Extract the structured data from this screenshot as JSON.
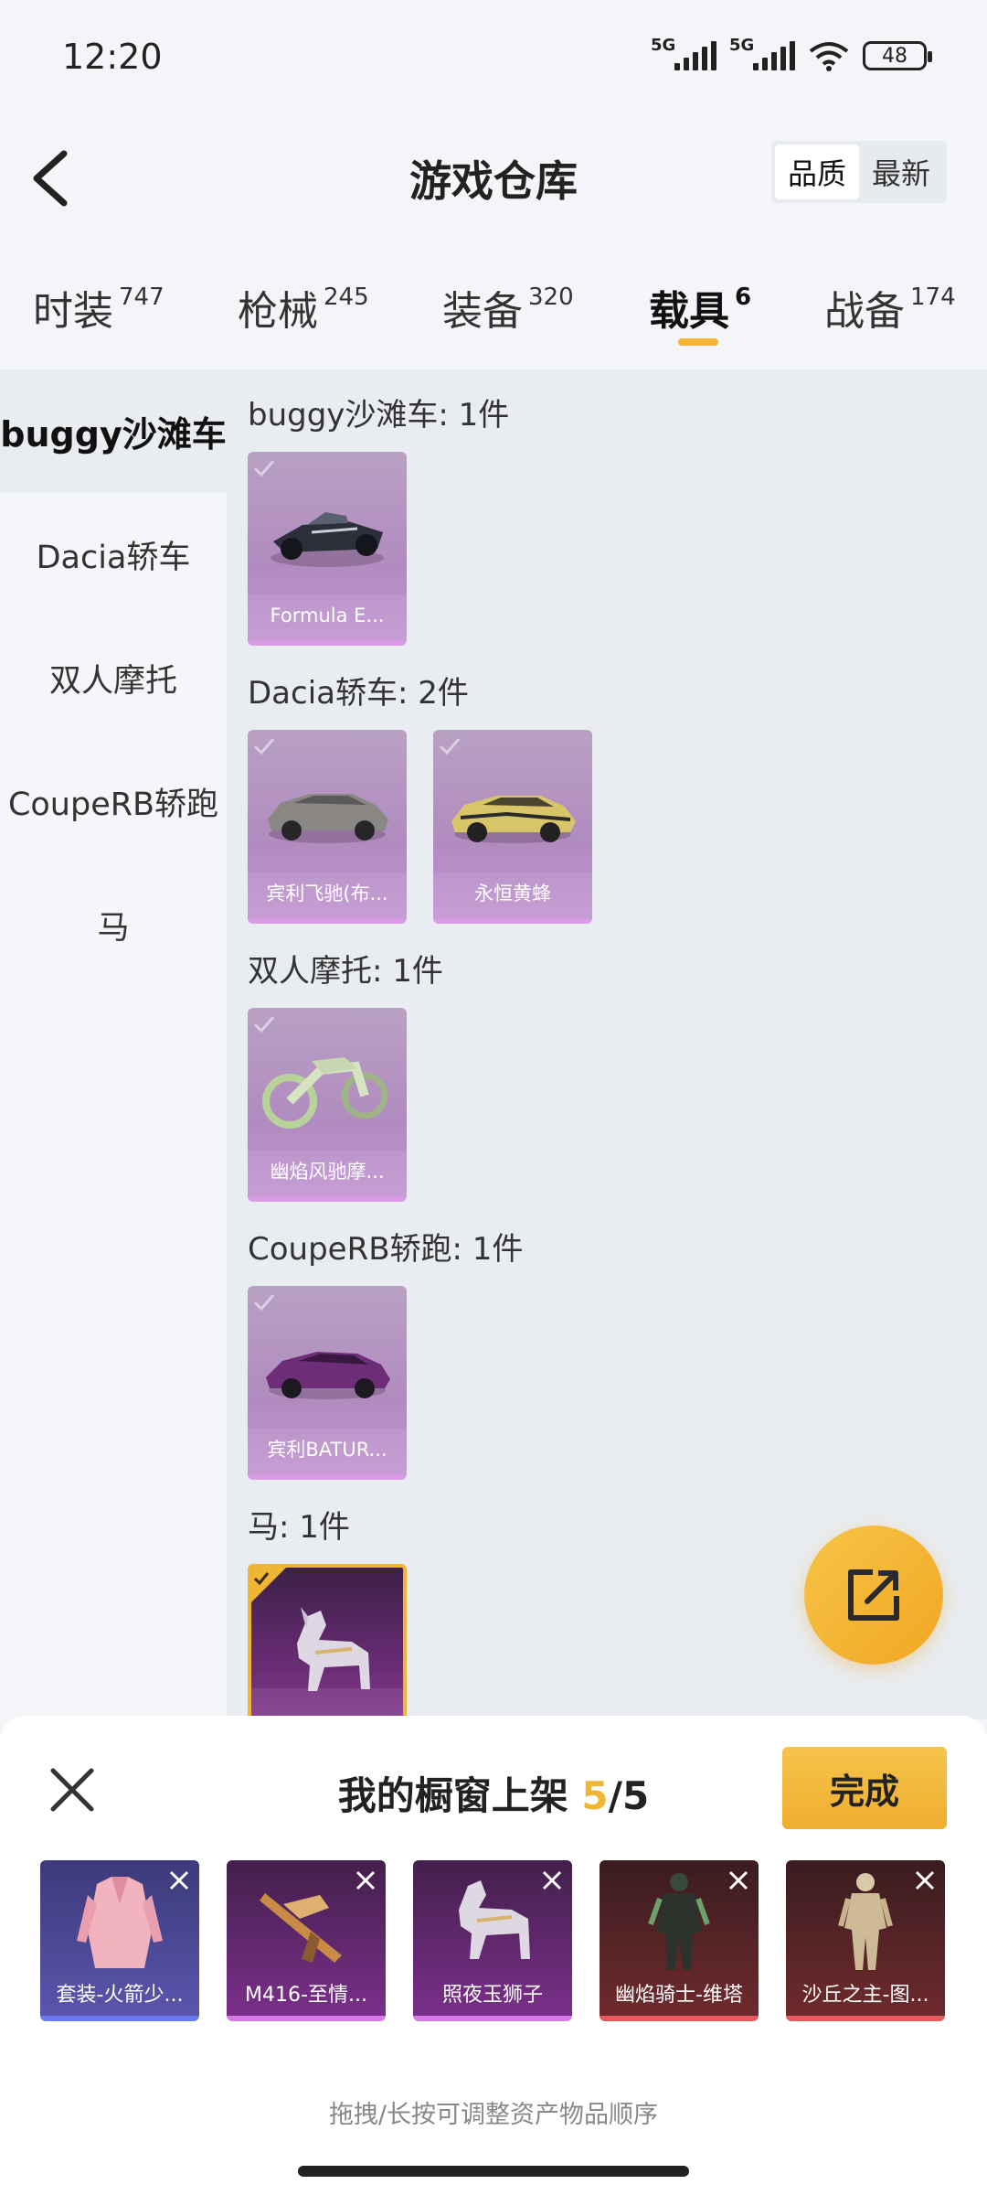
{
  "status_bar": {
    "time": "12:20",
    "net1": "5G",
    "net2": "5G",
    "wifi_sub": "7",
    "battery": "48"
  },
  "header": {
    "title": "游戏仓库",
    "sort_options": [
      "品质",
      "最新"
    ]
  },
  "tabs": [
    {
      "label": "时装",
      "count": "747"
    },
    {
      "label": "枪械",
      "count": "245"
    },
    {
      "label": "装备",
      "count": "320"
    },
    {
      "label": "载具",
      "count": "6"
    },
    {
      "label": "战备",
      "count": "174"
    }
  ],
  "sidebar": {
    "items": [
      "buggy沙滩车",
      "Dacia轿车",
      "双人摩托",
      "CoupeRB轿跑",
      "马"
    ]
  },
  "groups": [
    {
      "title": "buggy沙滩车: 1件",
      "items": [
        "Formula E..."
      ]
    },
    {
      "title": "Dacia轿车: 2件",
      "items": [
        "宾利飞驰(布...",
        "永恒黄蜂"
      ]
    },
    {
      "title": "双人摩托: 1件",
      "items": [
        "幽焰风驰摩..."
      ]
    },
    {
      "title": "CoupeRB轿跑: 1件",
      "items": [
        "宾利BATUR..."
      ]
    },
    {
      "title": "马: 1件",
      "items": [
        ""
      ]
    }
  ],
  "showcase": {
    "title": "我的橱窗上架",
    "current": "5",
    "total": "/5",
    "done_label": "完成",
    "slots": [
      "套装-火箭少...",
      "M416-至情...",
      "照夜玉狮子",
      "幽焰骑士-维塔",
      "沙丘之主-图..."
    ],
    "hint": "拖拽/长按可调整资产物品顺序"
  },
  "colors": {
    "accent": "#f0b532",
    "tab_underline": "#f3b334"
  }
}
